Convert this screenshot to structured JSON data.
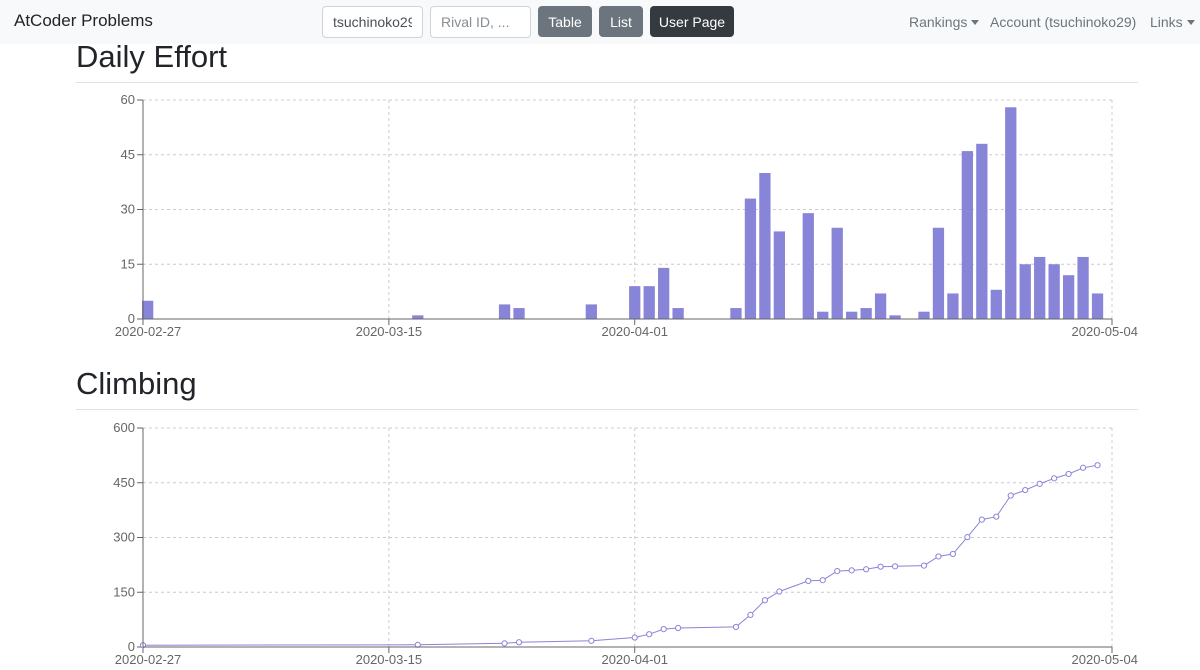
{
  "navbar": {
    "brand": "AtCoder Problems",
    "user_input_value": "tsuchinoko29",
    "rival_placeholder": "Rival ID, ...",
    "table_label": "Table",
    "list_label": "List",
    "user_page_label": "User Page",
    "rankings_label": "Rankings",
    "account_label": "Account (tsuchinoko29)",
    "links_label": "Links"
  },
  "sections": {
    "daily_effort_title": "Daily Effort",
    "climbing_title": "Climbing"
  },
  "colors": {
    "bar": "#8884d8",
    "line": "#8884d8",
    "grid": "#cccccc",
    "axis": "#666666"
  },
  "chart_data": [
    {
      "type": "bar",
      "title": "Daily Effort",
      "x_ticks": [
        "2020-02-27",
        "2020-03-15",
        "2020-04-01",
        "2020-05-04"
      ],
      "y_ticks": [
        0,
        15,
        30,
        45,
        60
      ],
      "ylim": [
        0,
        60
      ],
      "xlim": [
        "2020-02-27",
        "2020-05-04"
      ],
      "grid": true,
      "points": [
        {
          "date": "2020-02-27",
          "value": 5
        },
        {
          "date": "2020-03-17",
          "value": 1
        },
        {
          "date": "2020-03-23",
          "value": 4
        },
        {
          "date": "2020-03-24",
          "value": 3
        },
        {
          "date": "2020-03-29",
          "value": 4
        },
        {
          "date": "2020-04-01",
          "value": 9
        },
        {
          "date": "2020-04-02",
          "value": 9
        },
        {
          "date": "2020-04-03",
          "value": 14
        },
        {
          "date": "2020-04-04",
          "value": 3
        },
        {
          "date": "2020-04-08",
          "value": 3
        },
        {
          "date": "2020-04-09",
          "value": 33
        },
        {
          "date": "2020-04-10",
          "value": 40
        },
        {
          "date": "2020-04-11",
          "value": 24
        },
        {
          "date": "2020-04-13",
          "value": 29
        },
        {
          "date": "2020-04-14",
          "value": 2
        },
        {
          "date": "2020-04-15",
          "value": 25
        },
        {
          "date": "2020-04-16",
          "value": 2
        },
        {
          "date": "2020-04-17",
          "value": 3
        },
        {
          "date": "2020-04-18",
          "value": 7
        },
        {
          "date": "2020-04-19",
          "value": 1
        },
        {
          "date": "2020-04-21",
          "value": 2
        },
        {
          "date": "2020-04-22",
          "value": 25
        },
        {
          "date": "2020-04-23",
          "value": 7
        },
        {
          "date": "2020-04-24",
          "value": 46
        },
        {
          "date": "2020-04-25",
          "value": 48
        },
        {
          "date": "2020-04-26",
          "value": 8
        },
        {
          "date": "2020-04-27",
          "value": 58
        },
        {
          "date": "2020-04-28",
          "value": 15
        },
        {
          "date": "2020-04-29",
          "value": 17
        },
        {
          "date": "2020-04-30",
          "value": 15
        },
        {
          "date": "2020-05-01",
          "value": 12
        },
        {
          "date": "2020-05-02",
          "value": 17
        },
        {
          "date": "2020-05-03",
          "value": 7
        }
      ]
    },
    {
      "type": "line",
      "title": "Climbing",
      "x_ticks": [
        "2020-02-27",
        "2020-03-15",
        "2020-04-01",
        "2020-05-04"
      ],
      "y_ticks": [
        0,
        150,
        300,
        450,
        600
      ],
      "ylim": [
        0,
        600
      ],
      "xlim": [
        "2020-02-27",
        "2020-05-04"
      ],
      "grid": true,
      "points": [
        {
          "date": "2020-02-27",
          "value": 5
        },
        {
          "date": "2020-03-17",
          "value": 6
        },
        {
          "date": "2020-03-23",
          "value": 10
        },
        {
          "date": "2020-03-24",
          "value": 13
        },
        {
          "date": "2020-03-29",
          "value": 17
        },
        {
          "date": "2020-04-01",
          "value": 26
        },
        {
          "date": "2020-04-02",
          "value": 35
        },
        {
          "date": "2020-04-03",
          "value": 49
        },
        {
          "date": "2020-04-04",
          "value": 52
        },
        {
          "date": "2020-04-08",
          "value": 55
        },
        {
          "date": "2020-04-09",
          "value": 88
        },
        {
          "date": "2020-04-10",
          "value": 128
        },
        {
          "date": "2020-04-11",
          "value": 152
        },
        {
          "date": "2020-04-13",
          "value": 181
        },
        {
          "date": "2020-04-14",
          "value": 183
        },
        {
          "date": "2020-04-15",
          "value": 208
        },
        {
          "date": "2020-04-16",
          "value": 210
        },
        {
          "date": "2020-04-17",
          "value": 213
        },
        {
          "date": "2020-04-18",
          "value": 220
        },
        {
          "date": "2020-04-19",
          "value": 221
        },
        {
          "date": "2020-04-21",
          "value": 223
        },
        {
          "date": "2020-04-22",
          "value": 248
        },
        {
          "date": "2020-04-23",
          "value": 255
        },
        {
          "date": "2020-04-24",
          "value": 301
        },
        {
          "date": "2020-04-25",
          "value": 349
        },
        {
          "date": "2020-04-26",
          "value": 357
        },
        {
          "date": "2020-04-27",
          "value": 415
        },
        {
          "date": "2020-04-28",
          "value": 430
        },
        {
          "date": "2020-04-29",
          "value": 447
        },
        {
          "date": "2020-04-30",
          "value": 462
        },
        {
          "date": "2020-05-01",
          "value": 474
        },
        {
          "date": "2020-05-02",
          "value": 491
        },
        {
          "date": "2020-05-03",
          "value": 498
        }
      ]
    }
  ]
}
